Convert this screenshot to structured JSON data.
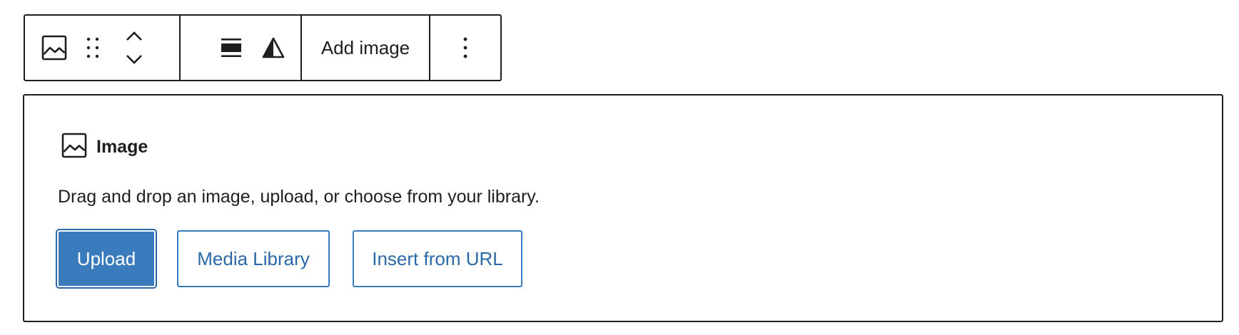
{
  "toolbar": {
    "icons": {
      "block_type": "image-icon",
      "drag": "drag-handle-icon",
      "move_up": "chevron-up-icon",
      "move_down": "chevron-down-icon",
      "align": "align-wide-icon",
      "duotone": "duotone-filter-icon",
      "more": "more-vertical-icon"
    },
    "add_image_label": "Add image"
  },
  "placeholder": {
    "icon": "image-icon",
    "title": "Image",
    "instructions": "Drag and drop an image, upload, or choose from your library.",
    "buttons": {
      "upload": "Upload",
      "media_library": "Media Library",
      "insert_from_url": "Insert from URL"
    }
  },
  "colors": {
    "text": "#1e1e1e",
    "primary": "#3a7bbd",
    "primary_text": "#ffffff",
    "link": "#2b68a7",
    "border": "#1e1e1e"
  }
}
